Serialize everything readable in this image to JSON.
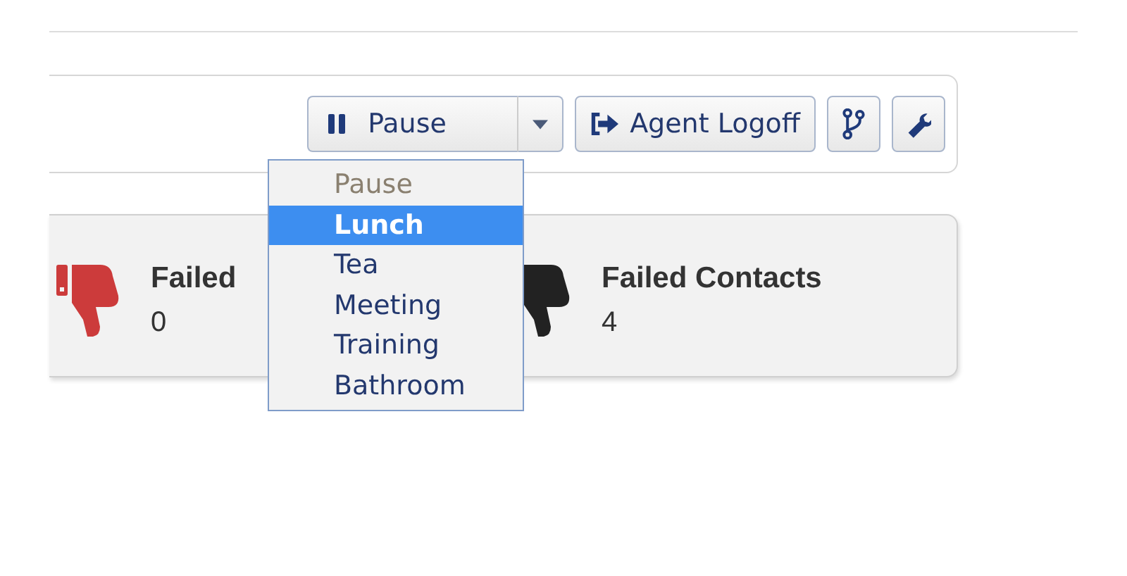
{
  "toolbar": {
    "status_button": {
      "label": "Pause"
    },
    "logoff_button": {
      "label": "Agent Logoff"
    }
  },
  "status_menu": {
    "options": [
      {
        "label": "Pause",
        "selected": false,
        "disabled": true
      },
      {
        "label": "Lunch",
        "selected": true,
        "disabled": false
      },
      {
        "label": "Tea",
        "selected": false,
        "disabled": false
      },
      {
        "label": "Meeting",
        "selected": false,
        "disabled": false
      },
      {
        "label": "Training",
        "selected": false,
        "disabled": false
      },
      {
        "label": "Bathroom",
        "selected": false,
        "disabled": false
      }
    ]
  },
  "stats": [
    {
      "title": "Failed",
      "value": "0",
      "color": "#cc3b3b"
    },
    {
      "title": "Failed Contacts",
      "value": "4",
      "color": "#222222"
    }
  ]
}
